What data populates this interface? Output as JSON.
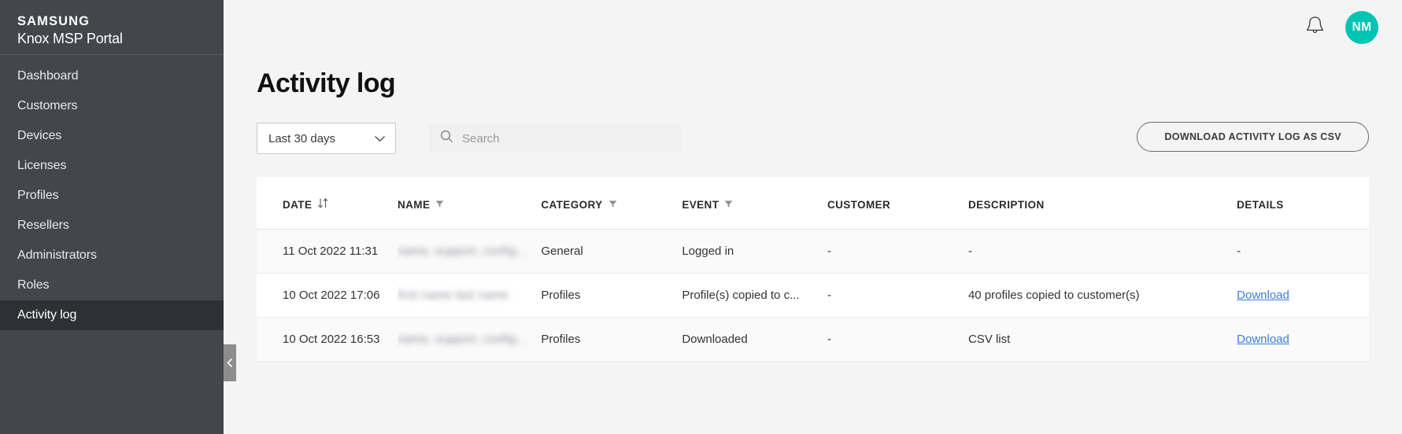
{
  "brand": {
    "company": "SAMSUNG",
    "product": "Knox MSP Portal"
  },
  "sidebar": {
    "items": [
      {
        "label": "Dashboard",
        "active": false
      },
      {
        "label": "Customers",
        "active": false
      },
      {
        "label": "Devices",
        "active": false
      },
      {
        "label": "Licenses",
        "active": false
      },
      {
        "label": "Profiles",
        "active": false
      },
      {
        "label": "Resellers",
        "active": false
      },
      {
        "label": "Administrators",
        "active": false
      },
      {
        "label": "Roles",
        "active": false
      },
      {
        "label": "Activity log",
        "active": true
      }
    ],
    "collapse_icon": "chevron-left-icon"
  },
  "topbar": {
    "notification_icon": "bell-icon",
    "avatar_initials": "NM",
    "avatar_color": "#00c4b4"
  },
  "page": {
    "title": "Activity log"
  },
  "toolbar": {
    "date_filter": {
      "value": "Last 30 days",
      "chevron_icon": "chevron-down-icon"
    },
    "search": {
      "value": "",
      "placeholder": "Search",
      "icon": "search-icon"
    },
    "download_csv_label": "DOWNLOAD ACTIVITY LOG AS CSV"
  },
  "table": {
    "columns": [
      {
        "label": "DATE",
        "icon": "sort-icon"
      },
      {
        "label": "NAME",
        "icon": "filter-icon"
      },
      {
        "label": "CATEGORY",
        "icon": "filter-icon"
      },
      {
        "label": "EVENT",
        "icon": "filter-icon"
      },
      {
        "label": "CUSTOMER",
        "icon": ""
      },
      {
        "label": "DESCRIPTION",
        "icon": ""
      },
      {
        "label": "DETAILS",
        "icon": ""
      }
    ],
    "rows": [
      {
        "date": "11 Oct 2022 11:31",
        "name": "name, support, config...",
        "name_redacted": true,
        "category": "General",
        "event": "Logged in",
        "customer": "-",
        "description": "-",
        "details": "-",
        "details_is_link": false
      },
      {
        "date": "10 Oct 2022 17:06",
        "name": "first name last name",
        "name_redacted": true,
        "category": "Profiles",
        "event": "Profile(s) copied to c...",
        "customer": "-",
        "description": "40 profiles copied to customer(s)",
        "details": "Download",
        "details_is_link": true
      },
      {
        "date": "10 Oct 2022 16:53",
        "name": "name, support, config...",
        "name_redacted": true,
        "category": "Profiles",
        "event": "Downloaded",
        "customer": "-",
        "description": "CSV list",
        "details": "Download",
        "details_is_link": true
      }
    ]
  }
}
